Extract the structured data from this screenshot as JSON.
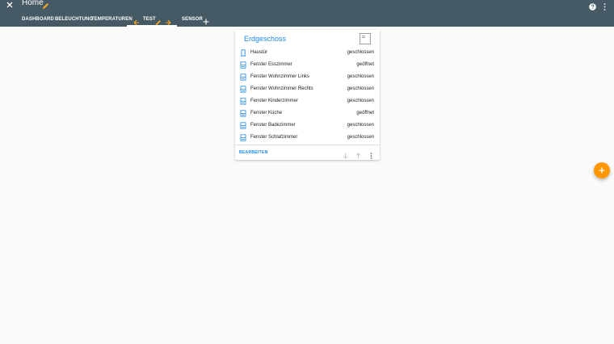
{
  "colors": {
    "toolbar": "#455a64",
    "accent": "#ff9800",
    "primary": "#1e88e5",
    "icon": "#1e88e5"
  },
  "header": {
    "title": "Home"
  },
  "tabs": [
    {
      "label": "DASHBOARD"
    },
    {
      "label": "BELEUCHTUNG"
    },
    {
      "label": "TEMPERATUREN"
    },
    {
      "label": "TEST",
      "selected": true
    },
    {
      "label": "SENSOR"
    }
  ],
  "card": {
    "title": "Erdgeschoss",
    "edit_label": "BEARBEITEN",
    "entities": [
      {
        "name": "Haustür",
        "state": "geschlossen",
        "icon": "door-icon"
      },
      {
        "name": "Fenster Esszimmer",
        "state": "geöffnet",
        "icon": "window-icon"
      },
      {
        "name": "Fenster Wohnzimmer Links",
        "state": "geschlossen",
        "icon": "window-icon"
      },
      {
        "name": "Fenster Wohnzimmer Rechts",
        "state": "geschlossen",
        "icon": "window-icon"
      },
      {
        "name": "Fenster Kinderzimmer",
        "state": "geschlossen",
        "icon": "window-icon"
      },
      {
        "name": "Fenster Küche",
        "state": "geöffnet",
        "icon": "window-icon"
      },
      {
        "name": "Fenster Badezimmer",
        "state": "geschlossen",
        "icon": "window-icon"
      },
      {
        "name": "Fenster Schlafzimmer",
        "state": "geschlossen",
        "icon": "window-icon"
      }
    ]
  }
}
